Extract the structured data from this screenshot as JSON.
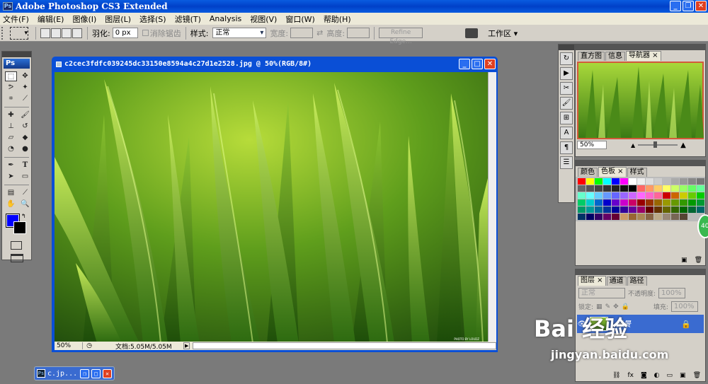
{
  "app": {
    "title": "Adobe Photoshop CS3 Extended",
    "ps_logo": "Ps"
  },
  "menu": [
    "文件(F)",
    "编辑(E)",
    "图像(I)",
    "图层(L)",
    "选择(S)",
    "滤镜(T)",
    "Analysis",
    "视图(V)",
    "窗口(W)",
    "帮助(H)"
  ],
  "options": {
    "feather_label": "羽化:",
    "feather_value": "0 px",
    "antialias": "消除锯齿",
    "style_label": "样式:",
    "style_value": "正常",
    "width_label": "宽度:",
    "height_label": "高度:",
    "refine_edge": "Refine Edge...",
    "workspace": "工作区 ▾"
  },
  "document": {
    "title": "c2cec3fdfc039245dc33150e8594a4c27d1e2528.jpg @ 50%(RGB/8#)",
    "zoom": "50%",
    "doc_info": "文档:5.05M/5.05M",
    "photo_credit": "PHOTO BY LOUDZ"
  },
  "navigator": {
    "tabs": [
      "直方图",
      "信息",
      "导航器 ×"
    ],
    "zoom": "50%"
  },
  "color_panel": {
    "tabs": [
      "颜色",
      "色板 ×",
      "样式"
    ]
  },
  "layers": {
    "tabs": [
      "图层 ×",
      "通道",
      "路径"
    ],
    "blend": "正常",
    "opacity_label": "不透明度:",
    "opacity": "100%",
    "lock_label": "锁定:",
    "fill_label": "填充:",
    "fill": "100%",
    "layer_name": "背景"
  },
  "taskbar": {
    "label": "c.jp..."
  },
  "watermark": {
    "brand": "Bai 经验",
    "url": "jingyan.baidu.com"
  },
  "badge": "40",
  "colors": {
    "foreground": "#0000ff",
    "background": "#000000",
    "title_blue": "#0a4fd6"
  }
}
